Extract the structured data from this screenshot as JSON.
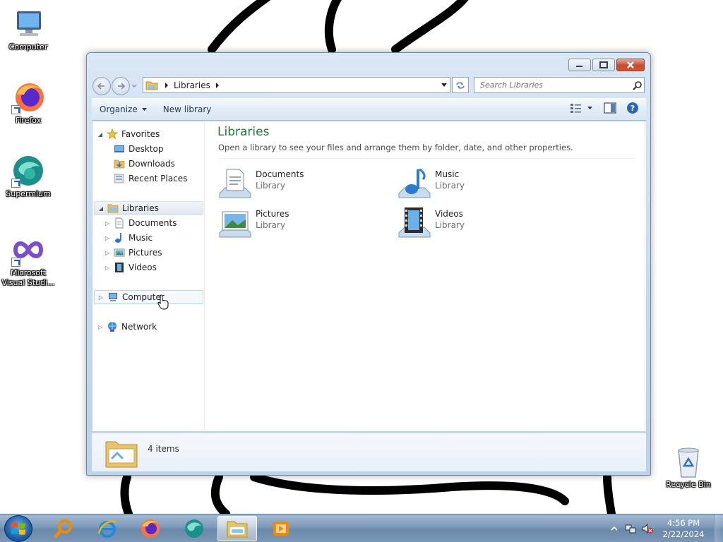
{
  "desktop": {
    "icons": [
      {
        "label": "Computer",
        "icon": "computer-icon"
      },
      {
        "label": "Firefox",
        "icon": "firefox-icon"
      },
      {
        "label": "Supermium",
        "icon": "supermium-icon"
      },
      {
        "label": "Microsoft Visual Studi...",
        "icon": "visual-studio-icon"
      },
      {
        "label": "Recycle Bin",
        "icon": "recycle-bin-icon"
      }
    ]
  },
  "window": {
    "address": {
      "crumb": "Libraries"
    },
    "search": {
      "placeholder": "Search Libraries"
    },
    "toolbar": {
      "organize_label": "Organize",
      "new_library_label": "New library"
    },
    "navpane": {
      "favorites": {
        "label": "Favorites",
        "items": [
          "Desktop",
          "Downloads",
          "Recent Places"
        ]
      },
      "libraries": {
        "label": "Libraries",
        "items": [
          "Documents",
          "Music",
          "Pictures",
          "Videos"
        ]
      },
      "computer_label": "Computer",
      "network_label": "Network"
    },
    "content": {
      "title": "Libraries",
      "description": "Open a library to see your files and arrange them by folder, date, and other properties.",
      "libraries": [
        {
          "name": "Documents",
          "type": "Library",
          "icon": "documents-library-icon"
        },
        {
          "name": "Music",
          "type": "Library",
          "icon": "music-library-icon"
        },
        {
          "name": "Pictures",
          "type": "Library",
          "icon": "pictures-library-icon"
        },
        {
          "name": "Videos",
          "type": "Library",
          "icon": "videos-library-icon"
        }
      ]
    },
    "details": {
      "item_count": "4 items"
    }
  },
  "taskbar": {
    "apps": [
      "search-app-icon",
      "internet-explorer-icon",
      "firefox-icon",
      "supermium-icon",
      "file-explorer-icon",
      "media-player-icon"
    ],
    "clock": {
      "time": "4:56 PM",
      "date": "2/22/2024"
    }
  },
  "colors": {
    "heading_green": "#1e7b33",
    "taskbar_blue": "#7d99b9",
    "selection_blue": "#b8d6fb"
  }
}
